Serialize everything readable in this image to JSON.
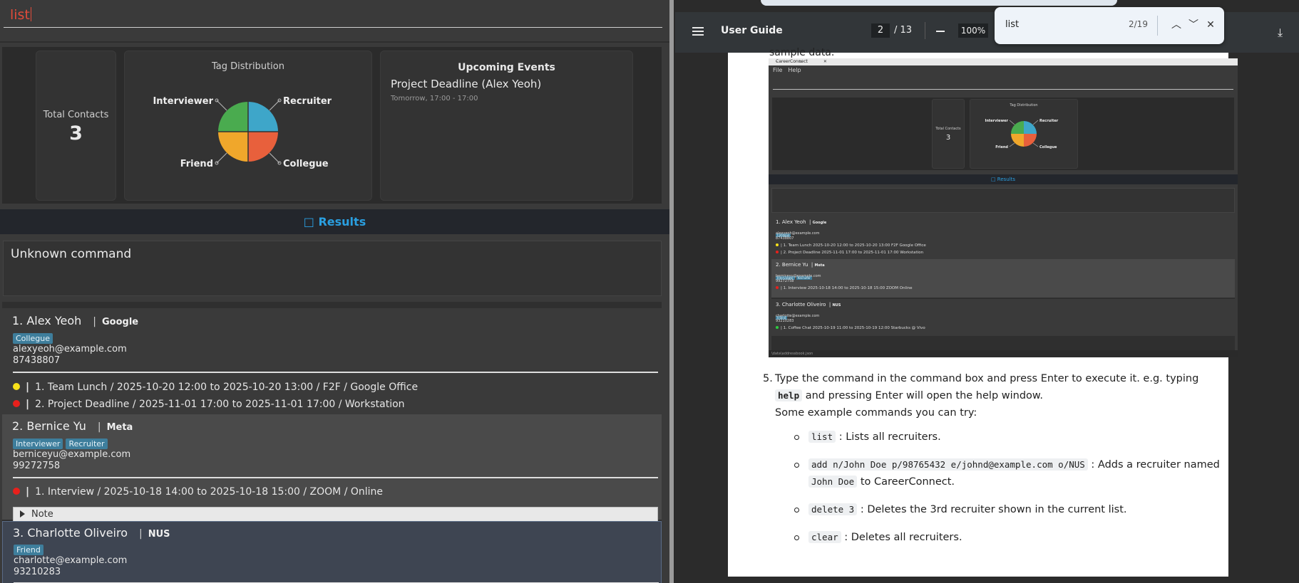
{
  "app": {
    "command_text": "list",
    "dashboard": {
      "total_contacts_label": "Total Contacts",
      "total_contacts_value": "3",
      "tag_distribution_title": "Tag Distribution",
      "pie_labels": [
        "Interviewer",
        "Recruiter",
        "Collegue",
        "Friend"
      ],
      "pie_colors": [
        "#4aab4f",
        "#3ea6c9",
        "#e8603c",
        "#f0a72b"
      ],
      "upcoming_title": "Upcoming Events",
      "upcoming_event_title": "Project Deadline (Alex Yeoh)",
      "upcoming_event_time": "Tomorrow, 17:00 - 17:00"
    },
    "results_label": "□ Results",
    "result_message": "Unknown command",
    "contacts": [
      {
        "name": "1. Alex Yeoh",
        "company": "Google",
        "tags": [
          "Collegue"
        ],
        "email": "alexyeoh@example.com",
        "phone": "87438807",
        "events": [
          {
            "color": "#f7e11a",
            "text": "1. Team Lunch / 2025-10-20 12:00 to 2025-10-20 13:00 / F2F / Google Office"
          },
          {
            "color": "#e8201c",
            "text": "2. Project Deadline / 2025-11-01 17:00 to 2025-11-01 17:00 / Workstation"
          }
        ]
      },
      {
        "name": "2. Bernice Yu",
        "company": "Meta",
        "tags": [
          "Interviewer",
          "Recruiter"
        ],
        "email": "berniceyu@example.com",
        "phone": "99272758",
        "events": [
          {
            "color": "#e8201c",
            "text": "1. Interview / 2025-10-18 14:00 to 2025-10-18 15:00 / ZOOM / Online"
          }
        ],
        "note_label": "Note"
      },
      {
        "name": "3. Charlotte Oliveiro",
        "company": "NUS",
        "tags": [
          "Friend"
        ],
        "email": "charlotte@example.com",
        "phone": "93210283"
      }
    ]
  },
  "viewer": {
    "title": "User Guide",
    "page_current": "2",
    "page_total": "/ 13",
    "zoom": "100%",
    "find_query": "list",
    "find_count": "2/19",
    "ghost_text": "sample data.",
    "embedded": {
      "window_title": "CareerConnect",
      "menu": [
        "File",
        "Help"
      ],
      "total_label": "Total Contacts",
      "total_value": "3",
      "tags_title": "Tag Distribution",
      "pie_labels": [
        "Interviewer",
        "Recruiter",
        "Friend",
        "Collegue"
      ],
      "results_label": "□ Results",
      "footer_path": "\\data\\addressbook.json",
      "contacts": [
        {
          "name": "1. Alex Yeoh",
          "company": "Google",
          "tags": [
            "Collegue"
          ],
          "email": "alexyeoh@example.com",
          "phone": "87438807",
          "events": [
            {
              "color": "#f7e11a",
              "text": "1. Team Lunch 2025-10-20 12:00 to 2025-10-20 13:00 F2F Google Office"
            },
            {
              "color": "#e8201c",
              "text": "2. Project Deadline 2025-11-01 17:00 to 2025-11-01 17:00 Workstation"
            }
          ]
        },
        {
          "name": "2. Bernice Yu",
          "company": "Meta",
          "tags": [
            "Interviewer",
            "Recruiter"
          ],
          "email": "berniceyu@example.com",
          "phone": "99272758",
          "events": [
            {
              "color": "#e8201c",
              "text": "1. Interview 2025-10-18 14:00 to 2025-10-18 15:00 ZOOM Online"
            }
          ]
        },
        {
          "name": "3. Charlotte Oliveiro",
          "company": "NUS",
          "tags": [
            "Friend"
          ],
          "email": "charlotte@example.com",
          "phone": "93210283",
          "events": [
            {
              "color": "#2ecc40",
              "text": "1. Coffee Chat 2025-10-19 11:00 to 2025-10-19 12:00 Starbucks @ Vivo"
            }
          ]
        }
      ]
    },
    "step_number": "5.",
    "step_text_1": "Type the command in the command box and press Enter to execute it. e.g. typing",
    "step_code": "help",
    "step_text_2": "and pressing Enter will open the help window.",
    "step_text_3": "Some example commands you can try:",
    "examples": [
      {
        "code": "list",
        "text": ": Lists all recruiters."
      },
      {
        "code": "add n/John Doe p/98765432 e/johnd@example.com o/NUS",
        "text": ": Adds a recruiter named",
        "code2": "John Doe",
        "text2": "to CareerConnect."
      },
      {
        "code": "delete 3",
        "text": ": Deletes the 3rd recruiter shown in the current list."
      },
      {
        "code": "clear",
        "text": ": Deletes all recruiters."
      }
    ]
  }
}
